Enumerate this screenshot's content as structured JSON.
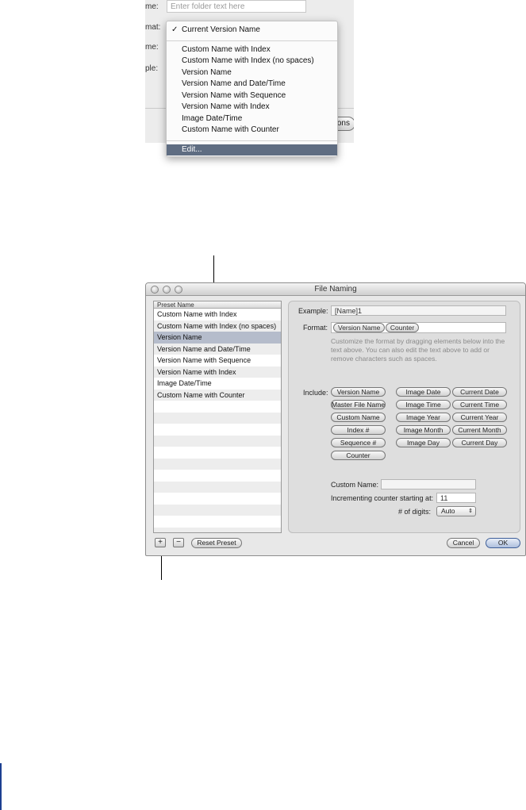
{
  "top_screenshot": {
    "labels": [
      "me:",
      "mat:",
      "me:",
      "ple:"
    ],
    "folder_placeholder": "Enter folder text here",
    "background_button_label": "ons",
    "menu": {
      "checked_item": "Current Version Name",
      "checkmark": "✓",
      "items": [
        "Custom Name with Index",
        "Custom Name with Index (no spaces)",
        "Version Name",
        "Version Name and Date/Time",
        "Version Name with Sequence",
        "Version Name with Index",
        "Image Date/Time",
        "Custom Name with Counter"
      ],
      "edit_item": "Edit..."
    }
  },
  "window": {
    "title": "File Naming",
    "preset_header": "Preset Name",
    "presets": [
      "Custom Name with Index",
      "Custom Name with Index (no spaces)",
      "Version Name",
      "Version Name and Date/Time",
      "Version Name with Sequence",
      "Version Name with Index",
      "Image Date/Time",
      "Custom Name with Counter"
    ],
    "selected_preset_index": 2,
    "example_label": "Example:",
    "example_value": "[Name]1",
    "format_label": "Format:",
    "format_tokens": [
      "Version Name",
      "Counter"
    ],
    "help_text": "Customize the format by dragging elements below into the text above. You can also edit the text above to add or remove characters such as spaces.",
    "include_label": "Include:",
    "include_tokens": [
      [
        "Version Name",
        "Image Date",
        "Current Date"
      ],
      [
        "Master File Name",
        "Image Time",
        "Current Time"
      ],
      [
        "Custom Name",
        "Image Year",
        "Current Year"
      ],
      [
        "Index #",
        "Image Month",
        "Current Month"
      ],
      [
        "Sequence #",
        "Image Day",
        "Current Day"
      ],
      [
        "Counter"
      ]
    ],
    "custom_name_label": "Custom Name:",
    "custom_name_value": "",
    "counter_label": "Incrementing counter starting at:",
    "counter_value": "11",
    "digits_label": "# of digits:",
    "digits_value": "Auto",
    "add_button": "+",
    "remove_button": "−",
    "reset_button": "Reset Preset",
    "cancel_button": "Cancel",
    "ok_button": "OK"
  }
}
